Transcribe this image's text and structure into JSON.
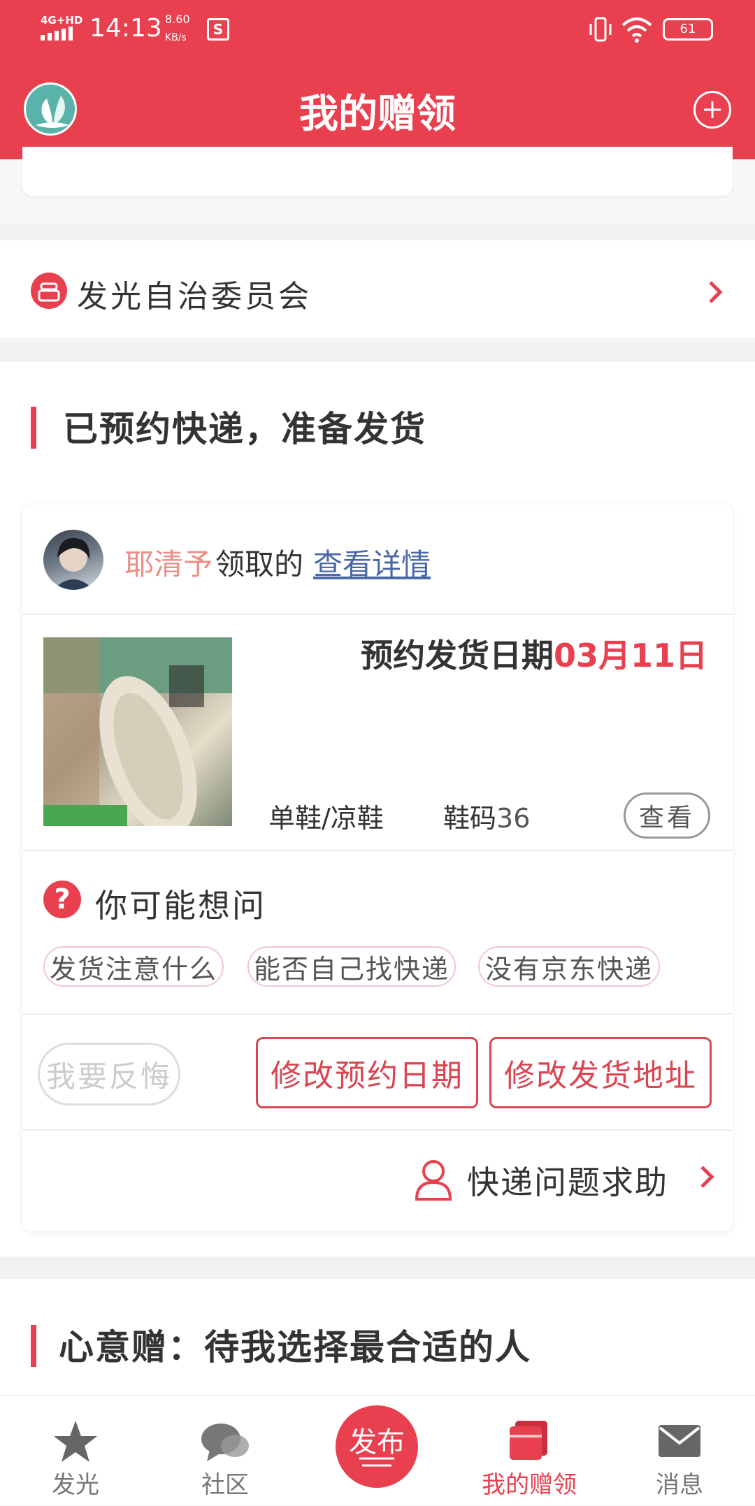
{
  "status_bar": {
    "network": "4G+HD",
    "time": "14:13",
    "speed_value": "8.60",
    "speed_unit": "KB/s",
    "battery": "61"
  },
  "app_bar": {
    "title": "我的赠领"
  },
  "committee": {
    "label": "发光自治委员会"
  },
  "section1": {
    "title": "已预约快递，准备发货"
  },
  "order": {
    "user_name": "耶清予",
    "claimed_text": "领取的",
    "details_link": "查看详情",
    "ship_date_label": "预约发货日期",
    "ship_date_value": "03月11日",
    "category": "单鞋/凉鞋",
    "size_label": "鞋码",
    "size_value": "36",
    "view_button": "查看"
  },
  "faq": {
    "title": "你可能想问",
    "chips": [
      "发货注意什么",
      "能否自己找快递",
      "没有京东快递"
    ]
  },
  "actions": {
    "regret": "我要反悔",
    "modify_date": "修改预约日期",
    "modify_address": "修改发货地址"
  },
  "help": {
    "label": "快递问题求助"
  },
  "section2": {
    "title": "心意赠：待我选择最合适的人"
  },
  "bottom_nav": {
    "items": [
      {
        "label": "发光",
        "icon": "star-icon"
      },
      {
        "label": "社区",
        "icon": "chat-icon"
      },
      {
        "label": "发布",
        "icon": "publish-icon"
      },
      {
        "label": "我的赠领",
        "icon": "gift-icon"
      },
      {
        "label": "消息",
        "icon": "mail-icon"
      }
    ],
    "active": "我的赠领"
  },
  "colors": {
    "accent": "#e8404f",
    "link": "#4a67a8",
    "username": "#f08b86"
  }
}
